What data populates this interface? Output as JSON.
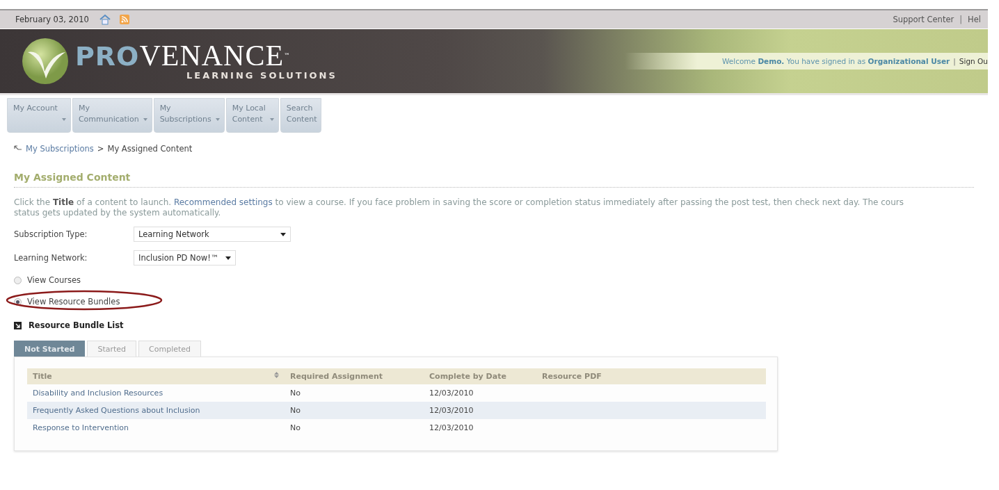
{
  "top_bar": {
    "date": "February 03, 2010",
    "links": [
      "Support Center",
      "Hel"
    ],
    "separator": "|"
  },
  "header": {
    "logo_pro": "PRO",
    "logo_venance": "VENANCE",
    "logo_tm": "™",
    "logo_sub": "LEARNING SOLUTIONS",
    "welcome": "Welcome",
    "user": "Demo.",
    "signed_in": "You have signed in as",
    "role": "Organizational User",
    "separator": "|",
    "sign_out": "Sign Ou"
  },
  "nav": [
    {
      "line1": "My Account",
      "dropdown": true
    },
    {
      "line1": "My",
      "line2": "Communication",
      "dropdown": true
    },
    {
      "line1": "My",
      "line2": "Subscriptions",
      "dropdown": true
    },
    {
      "line1": "My Local",
      "line2": "Content",
      "dropdown": true
    },
    {
      "line1": "Search",
      "line2": "Content",
      "dropdown": false
    }
  ],
  "breadcrumb": {
    "link": "My Subscriptions",
    "separator": ">",
    "current": "My Assigned Content"
  },
  "heading": "My Assigned Content",
  "intro": {
    "prefix": "Click the **Title** of a content to launch. ",
    "link": "Recommended settings",
    "suffix": " to view a course. If you face problem in saving the score or completion status immediately after passing the post test, then check next day. The cours",
    "line2": "status gets updated by the system automatically."
  },
  "filters": [
    {
      "label": "Subscription Type:",
      "value": "Learning Network",
      "wide": true
    },
    {
      "label": "Learning Network:",
      "value": "Inclusion PD Now!™",
      "wide": false
    }
  ],
  "views": [
    {
      "label": "View Courses",
      "selected": false,
      "circled": false
    },
    {
      "label": "View Resource Bundles",
      "selected": true,
      "circled": true
    }
  ],
  "section_title": "Resource Bundle List",
  "tabs": [
    {
      "label": "Not Started",
      "selected": true
    },
    {
      "label": "Started",
      "selected": false
    },
    {
      "label": "Completed",
      "selected": false
    }
  ],
  "table": {
    "columns": [
      {
        "label": "Title",
        "sortable": true
      },
      {
        "label": "Required Assignment",
        "sortable": false
      },
      {
        "label": "Complete by Date",
        "sortable": false
      },
      {
        "label": "Resource PDF",
        "sortable": false
      }
    ],
    "rows": [
      [
        "Disability and Inclusion Resources",
        "No",
        "12/03/2010"
      ],
      [
        "Frequently Asked Questions about Inclusion",
        "No",
        "12/03/2010"
      ],
      [
        "Response to Intervention",
        "No",
        "12/03/2010"
      ]
    ]
  }
}
